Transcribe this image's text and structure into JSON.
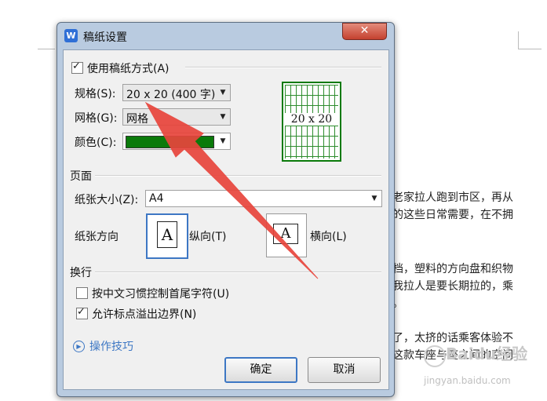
{
  "document": {
    "lines": [
      "老家拉人跑到市区，再从",
      "的这些日常需要，在不拥",
      "档，塑料的方向盘和织物",
      "我拉人是要长期拉的，乘",
      "。",
      "了，太挤的话乘客体验不",
      "这款车座与座之间的空间"
    ],
    "watermark": "Baidu经验",
    "watermark_url": "jingyan.baidu.com"
  },
  "dialog": {
    "app_icon": "W",
    "title": "稿纸设置",
    "close_glyph": "✕",
    "use_paper": {
      "label": "使用稿纸方式(A)",
      "checked": true
    },
    "spec": {
      "label": "规格(S):",
      "value": "20 x 20 (400 字)"
    },
    "grid": {
      "label": "网格(G):",
      "value": "网格"
    },
    "color": {
      "label": "颜色(C):",
      "value": "#0a7a0a"
    },
    "preview_text": "20 x 20",
    "page_section": "页面",
    "paper_size": {
      "label": "纸张大小(Z):",
      "value": "A4"
    },
    "orientation": {
      "label": "纸张方向",
      "portrait": "纵向(T)",
      "landscape": "横向(L)",
      "selected": "portrait",
      "glyph": "A"
    },
    "wrap_section": "换行",
    "wrap_options": [
      {
        "label": "按中文习惯控制首尾字符(U)",
        "checked": false
      },
      {
        "label": "允许标点溢出边界(N)",
        "checked": true
      }
    ],
    "tips": "操作技巧",
    "ok": "确定",
    "cancel": "取消"
  },
  "colors": {
    "accent": "#3d77c4",
    "annotation_arrow": "#e8453c"
  }
}
